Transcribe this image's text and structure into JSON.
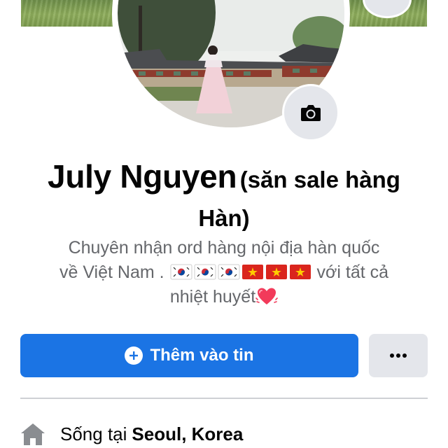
{
  "profile": {
    "name": "July Nguyen",
    "name_suffix_line1": "(săn sale hàng",
    "name_suffix_line2": "Hàn)",
    "bio_line1": "Chuyên nhận ord hàng nội địa hàn quốc",
    "bio_line2_start": "về Việt Nam .",
    "bio_line2_end": "với tất cả",
    "bio_line3": "nhiệt huyết",
    "flags": [
      "south-korea-flag",
      "south-korea-flag",
      "south-korea-flag",
      "vietnam-flag",
      "vietnam-flag",
      "vietnam-flag"
    ],
    "emoji": "beating-heart-icon"
  },
  "actions": {
    "add_story_label": "Thêm vào tin",
    "more_icon": "more-dots-icon",
    "primary_color": "#1b74e4"
  },
  "intro": {
    "lives_in_prefix": "Sống tại",
    "lives_in_place": "Seoul, Korea",
    "icon": "home-icon"
  }
}
